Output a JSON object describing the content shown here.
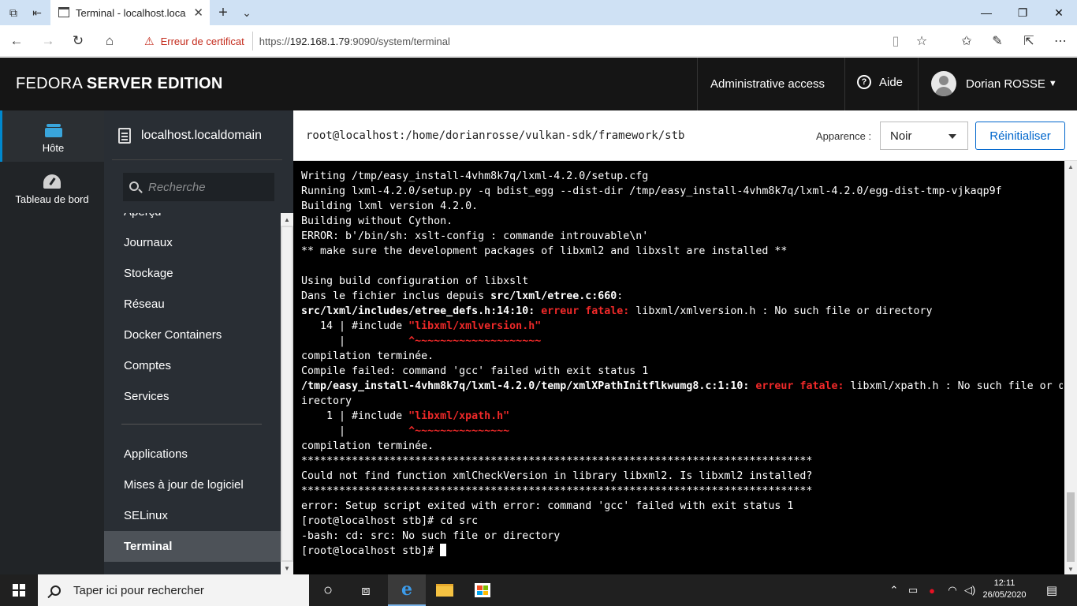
{
  "browser": {
    "tab_title": "Terminal - localhost.loca",
    "cert_warning": "Erreur de certificat",
    "url_prefix": "https://",
    "url_host": "192.168.1.79",
    "url_rest": ":9090/system/terminal"
  },
  "header": {
    "brand_light": "FEDORA",
    "brand_bold": "SERVER EDITION",
    "admin_access": "Administrative access",
    "help": "Aide",
    "user_name": "Dorian ROSSE"
  },
  "rail": {
    "items": [
      {
        "label": "Hôte",
        "icon": "server-icon",
        "active": true
      },
      {
        "label": "Tableau de bord",
        "icon": "dashboard-icon",
        "active": false
      }
    ]
  },
  "sidebar": {
    "host": "localhost.localdomain",
    "search_placeholder": "Recherche",
    "items": [
      {
        "label": "Aperçu"
      },
      {
        "label": "Journaux"
      },
      {
        "label": "Stockage"
      },
      {
        "label": "Réseau"
      },
      {
        "label": "Docker Containers"
      },
      {
        "label": "Comptes"
      },
      {
        "label": "Services"
      },
      {
        "label": "Applications"
      },
      {
        "label": "Mises à jour de logiciel"
      },
      {
        "label": "SELinux"
      },
      {
        "label": "Terminal",
        "active": true
      }
    ]
  },
  "terminal_header": {
    "path": "root@localhost:/home/dorianrosse/vulkan-sdk/framework/stb",
    "appearance_label": "Apparence :",
    "theme_value": "Noir",
    "reset_label": "Réinitialiser"
  },
  "terminal": {
    "lines": [
      [
        {
          "t": "Writing /tmp/easy_install-4vhm8k7q/lxml-4.2.0/setup.cfg"
        }
      ],
      [
        {
          "t": "Running lxml-4.2.0/setup.py -q bdist_egg --dist-dir /tmp/easy_install-4vhm8k7q/lxml-4.2.0/egg-dist-tmp-vjkaqp9f"
        }
      ],
      [
        {
          "t": "Building lxml version 4.2.0."
        }
      ],
      [
        {
          "t": "Building without Cython."
        }
      ],
      [
        {
          "t": "ERROR: b'/bin/sh: xslt-config : commande introuvable\\n'"
        }
      ],
      [
        {
          "t": "** make sure the development packages of libxml2 and libxslt are installed **"
        }
      ],
      [
        {
          "t": ""
        }
      ],
      [
        {
          "t": "Using build configuration of libxslt"
        }
      ],
      [
        {
          "t": "Dans le fichier inclus depuis "
        },
        {
          "t": "src/lxml/etree.c:660",
          "s": "b"
        },
        {
          "t": ":"
        }
      ],
      [
        {
          "t": "src/lxml/includes/etree_defs.h:14:10:",
          "s": "b"
        },
        {
          "t": " "
        },
        {
          "t": "erreur fatale:",
          "s": "r"
        },
        {
          "t": " libxml/xmlversion.h : No such file or directory"
        }
      ],
      [
        {
          "t": "   14 | #include "
        },
        {
          "t": "\"libxml/xmlversion.h\"",
          "s": "r"
        }
      ],
      [
        {
          "t": "      |          "
        },
        {
          "t": "^~~~~~~~~~~~~~~~~~~~~",
          "s": "r"
        }
      ],
      [
        {
          "t": "compilation terminée."
        }
      ],
      [
        {
          "t": "Compile failed: command 'gcc' failed with exit status 1"
        }
      ],
      [
        {
          "t": "/tmp/easy_install-4vhm8k7q/lxml-4.2.0/temp/xmlXPathInitflkwumg8.c:1:10:",
          "s": "b"
        },
        {
          "t": " "
        },
        {
          "t": "erreur fatale:",
          "s": "r"
        },
        {
          "t": " libxml/xpath.h : No such file or d"
        }
      ],
      [
        {
          "t": "irectory"
        }
      ],
      [
        {
          "t": "    1 | #include "
        },
        {
          "t": "\"libxml/xpath.h\"",
          "s": "r"
        }
      ],
      [
        {
          "t": "      |          "
        },
        {
          "t": "^~~~~~~~~~~~~~~~",
          "s": "r"
        }
      ],
      [
        {
          "t": "compilation terminée."
        }
      ],
      [
        {
          "t": "*********************************************************************************"
        }
      ],
      [
        {
          "t": "Could not find function xmlCheckVersion in library libxml2. Is libxml2 installed?"
        }
      ],
      [
        {
          "t": "*********************************************************************************"
        }
      ],
      [
        {
          "t": "error: Setup script exited with error: command 'gcc' failed with exit status 1"
        }
      ],
      [
        {
          "t": "[root@localhost stb]# cd src"
        }
      ],
      [
        {
          "t": "-bash: cd: src: No such file or directory"
        }
      ],
      [
        {
          "t": "[root@localhost stb]# "
        }
      ]
    ]
  },
  "taskbar": {
    "search_placeholder": "Taper ici pour rechercher",
    "time": "12:11",
    "date": "26/05/2020"
  }
}
